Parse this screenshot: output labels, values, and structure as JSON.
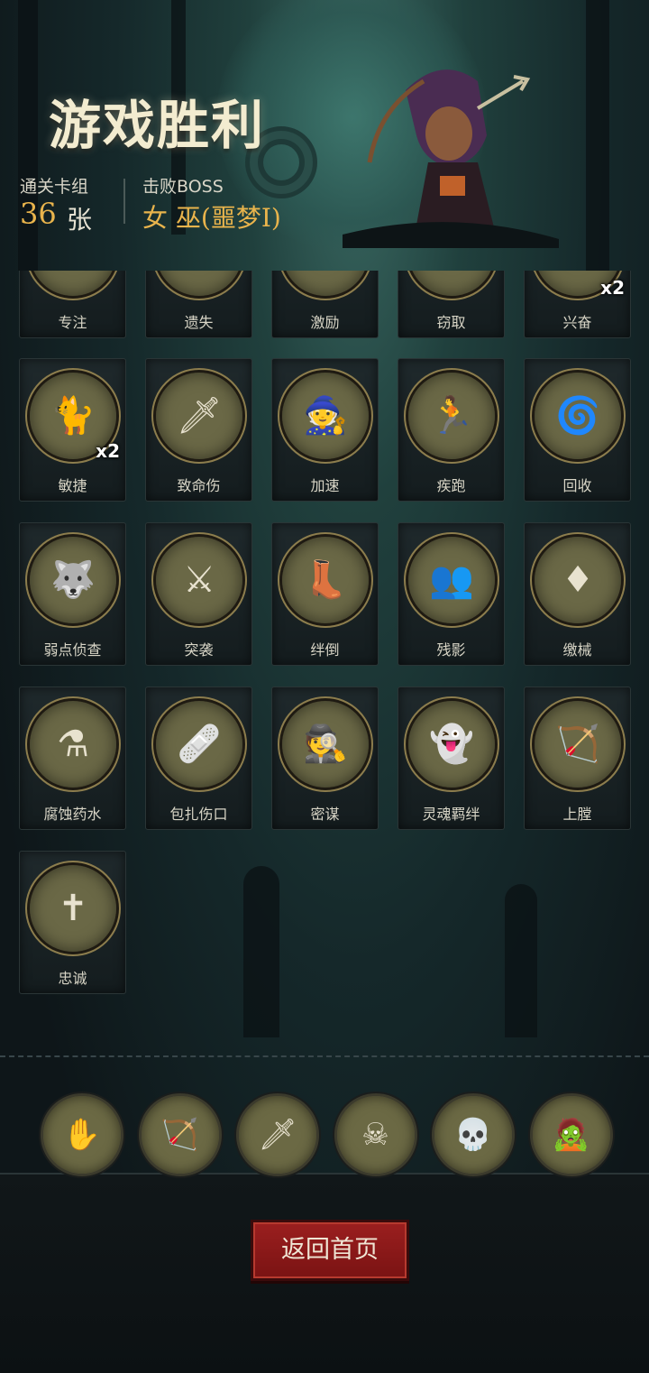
{
  "header": {
    "title": "游戏胜利",
    "deck_label": "通关卡组",
    "deck_count": "36",
    "deck_unit": "张",
    "boss_label": "击败BOSS",
    "boss_name": "女 巫(噩梦I)"
  },
  "cards_partial_row": [
    {
      "label": "专注",
      "icon": "focus-icon",
      "badge": ""
    },
    {
      "label": "遗失",
      "icon": "lost-icon",
      "badge": ""
    },
    {
      "label": "激励",
      "icon": "inspire-icon",
      "badge": ""
    },
    {
      "label": "窃取",
      "icon": "steal-icon",
      "badge": ""
    },
    {
      "label": "兴奋",
      "icon": "excite-icon",
      "badge": "x2"
    }
  ],
  "cards": [
    {
      "label": "敏捷",
      "icon": "agility-cat-icon",
      "glyph": "🐈",
      "badge": "x2"
    },
    {
      "label": "致命伤",
      "icon": "fatal-wound-icon",
      "glyph": "🗡",
      "badge": ""
    },
    {
      "label": "加速",
      "icon": "haste-witch-icon",
      "glyph": "🧙",
      "badge": ""
    },
    {
      "label": "疾跑",
      "icon": "sprint-icon",
      "glyph": "🏃",
      "badge": ""
    },
    {
      "label": "回收",
      "icon": "recycle-icon",
      "glyph": "🌀",
      "badge": ""
    },
    {
      "label": "弱点侦查",
      "icon": "weakness-scout-wolf-icon",
      "glyph": "🐺",
      "badge": ""
    },
    {
      "label": "突袭",
      "icon": "raid-icon",
      "glyph": "⚔",
      "badge": ""
    },
    {
      "label": "绊倒",
      "icon": "trip-boot-icon",
      "glyph": "👢",
      "badge": ""
    },
    {
      "label": "残影",
      "icon": "afterimage-icon",
      "glyph": "👥",
      "badge": ""
    },
    {
      "label": "缴械",
      "icon": "disarm-icon",
      "glyph": "♦",
      "badge": ""
    },
    {
      "label": "腐蚀药水",
      "icon": "corrosive-potion-icon",
      "glyph": "⚗",
      "badge": ""
    },
    {
      "label": "包扎伤口",
      "icon": "bandage-doctor-icon",
      "glyph": "🩹",
      "badge": ""
    },
    {
      "label": "密谋",
      "icon": "conspiracy-icon",
      "glyph": "🕵",
      "badge": ""
    },
    {
      "label": "灵魂羁绊",
      "icon": "soul-bond-icon",
      "glyph": "👻",
      "badge": ""
    },
    {
      "label": "上膛",
      "icon": "crossbow-load-icon",
      "glyph": "🏹",
      "badge": ""
    },
    {
      "label": "忠诚",
      "icon": "loyalty-cross-icon",
      "glyph": "✝",
      "badge": ""
    }
  ],
  "relics": [
    {
      "icon": "cursed-hand-icon",
      "glyph": "✋"
    },
    {
      "icon": "crossbow-relic-icon",
      "glyph": "🏹"
    },
    {
      "icon": "dagger-relic-icon",
      "glyph": "🗡"
    },
    {
      "icon": "poison-relic-icon",
      "glyph": "☠"
    },
    {
      "icon": "skull-relic-icon",
      "glyph": "💀"
    },
    {
      "icon": "zombie-relic-icon",
      "glyph": "🧟"
    }
  ],
  "footer": {
    "home_button": "返回首页"
  },
  "colors": {
    "accent_gold": "#e9b44c",
    "button_red": "#8b1a1a"
  }
}
